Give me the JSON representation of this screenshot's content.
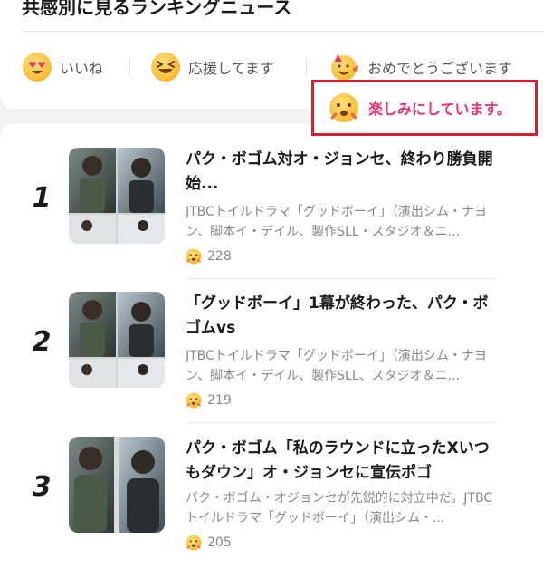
{
  "section_title": "共感別に見るランキングニュース",
  "reaction_tabs": [
    {
      "label": "いいね",
      "icon": "heart-eyes-emoji-icon"
    },
    {
      "label": "応援してます",
      "icon": "grinning-squint-emoji-icon"
    },
    {
      "label": "おめでとうございます",
      "icon": "party-emoji-icon"
    }
  ],
  "selected_tab": {
    "label": "楽しみにしています。",
    "icon": "excited-emoji-icon"
  },
  "colors": {
    "accent": "#e8336b",
    "highlight_border": "#d32030",
    "emoji_yellow": "#f8c43a"
  },
  "news": [
    {
      "rank": "1",
      "title": "パク・ボゴム対オ・ジョンセ、終わり勝負開始...",
      "desc": "JTBCトイルドラマ「グッドボーイ」（演出シム・ナヨン、脚本イ・デイル、製作SLL・スタジオ＆ニ...",
      "count": "228"
    },
    {
      "rank": "2",
      "title": "「グッドボーイ」1幕が終わった、パク・ボゴムvs",
      "desc": "JTBCトイルドラマ「グッドボーイ」（演出シム・ナヨン、脚本イ・デイル、製作SLL、スタジオ＆ニ...",
      "count": "219"
    },
    {
      "rank": "3",
      "title": "パク・ボゴム「私のラウンドに立ったXいつもダウン」オ・ジョンセに宣伝ポゴ",
      "desc": "パク・ボゴム・オジョンセが先鋭的に対立中だ。JTBCトイルドラマ「グッドボーイ」（演出シム・...",
      "count": "205"
    }
  ]
}
